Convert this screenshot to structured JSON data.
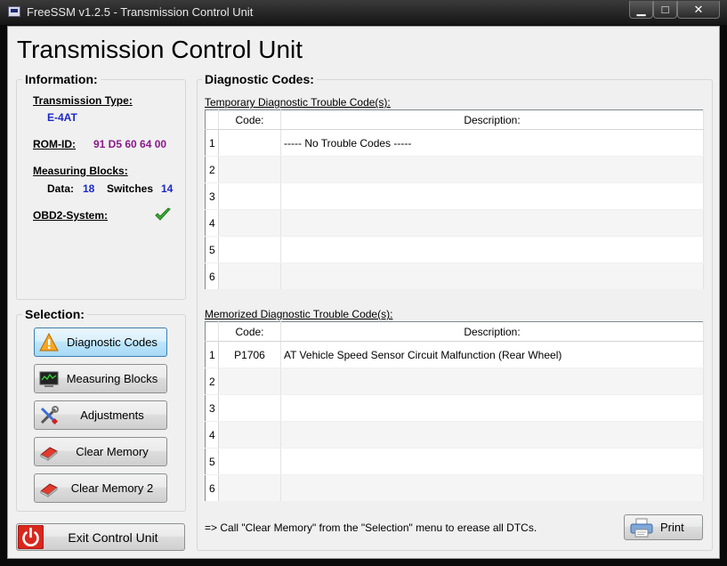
{
  "window": {
    "title": "FreeSSM v1.2.5 - Transmission Control Unit",
    "min_symbol": "▁",
    "max_symbol": "□",
    "close_symbol": "✕"
  },
  "page": {
    "title": "Transmission Control Unit"
  },
  "information": {
    "heading": "Information:",
    "transmission_type_label": "Transmission Type:",
    "transmission_type_value": "E-4AT",
    "rom_id_label": "ROM-ID:",
    "rom_id_value": "91 D5 60 64 00",
    "measuring_blocks_label": "Measuring Blocks:",
    "data_label": "Data:",
    "data_value": "18",
    "switches_label": "Switches",
    "switches_value": "14",
    "obd2_label": "OBD2-System:",
    "obd2_status_icon": "green-checkmark-icon"
  },
  "selection": {
    "heading": "Selection:",
    "buttons": [
      {
        "label": "Diagnostic Codes",
        "icon": "warning-icon",
        "active": true
      },
      {
        "label": "Measuring Blocks",
        "icon": "monitor-icon",
        "active": false
      },
      {
        "label": "Adjustments",
        "icon": "tools-icon",
        "active": false
      },
      {
        "label": "Clear Memory",
        "icon": "eraser-icon",
        "active": false
      },
      {
        "label": "Clear Memory 2",
        "icon": "eraser-icon",
        "active": false
      }
    ]
  },
  "exit": {
    "label": "Exit Control Unit",
    "icon": "power-icon"
  },
  "diagnostic": {
    "heading": "Diagnostic Codes:",
    "temporary_caption": "Temporary Diagnostic Trouble Code(s):",
    "memorized_caption": "Memorized Diagnostic Trouble Code(s):",
    "col_code": "Code:",
    "col_description": "Description:",
    "temporary_rows": [
      {
        "num": "1",
        "code": "",
        "description": "----- No Trouble Codes -----"
      },
      {
        "num": "2",
        "code": "",
        "description": ""
      },
      {
        "num": "3",
        "code": "",
        "description": ""
      },
      {
        "num": "4",
        "code": "",
        "description": ""
      },
      {
        "num": "5",
        "code": "",
        "description": ""
      },
      {
        "num": "6",
        "code": "",
        "description": ""
      }
    ],
    "memorized_rows": [
      {
        "num": "1",
        "code": "P1706",
        "description": "AT Vehicle Speed Sensor Circuit Malfunction (Rear Wheel)"
      },
      {
        "num": "2",
        "code": "",
        "description": ""
      },
      {
        "num": "3",
        "code": "",
        "description": ""
      },
      {
        "num": "4",
        "code": "",
        "description": ""
      },
      {
        "num": "5",
        "code": "",
        "description": ""
      },
      {
        "num": "6",
        "code": "",
        "description": ""
      }
    ],
    "hint": "=> Call \"Clear Memory\" from the \"Selection\" menu to erease all DTCs.",
    "print_label": "Print"
  },
  "colors": {
    "value_blue": "#1c28c8",
    "rom_purple": "#8a1a8a",
    "active_button": "#bee6fd",
    "exit_red": "#d8281e"
  }
}
